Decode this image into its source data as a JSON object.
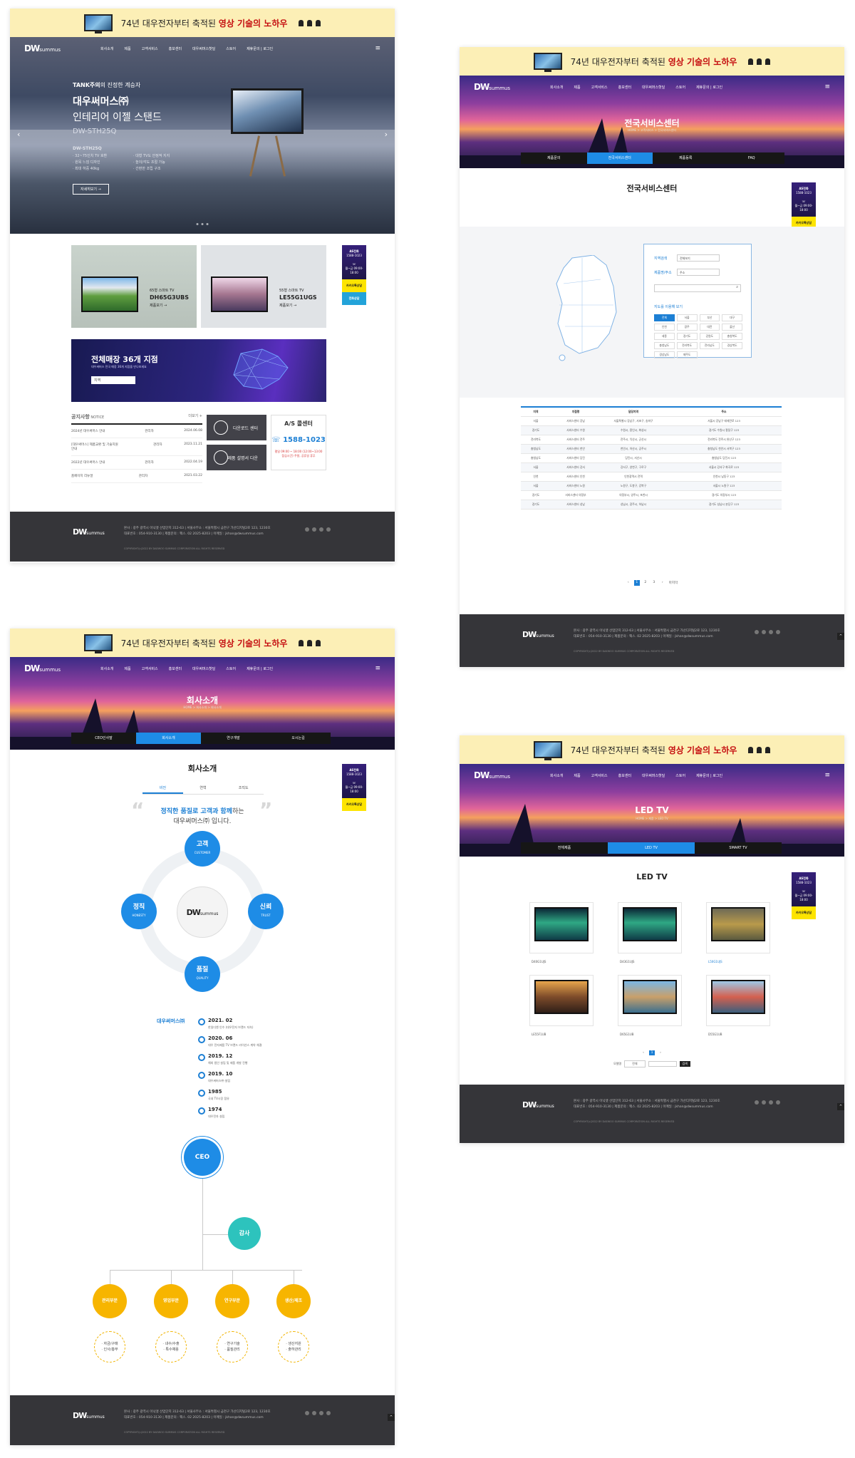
{
  "banner": {
    "prefix": "74년 대우전자부터 축적된 ",
    "highlight": "영상 기술의 노하우"
  },
  "logo": {
    "main": "DW",
    "sub": "summus"
  },
  "nav": [
    "회사소개",
    "제품",
    "고객서비스",
    "홍보센터",
    "대우써머스핫딜",
    "스토어",
    "제휴문의 | 로그인"
  ],
  "main_page": {
    "hero": {
      "sub_prefix": "TANK주의",
      "sub_suffix": "의 진정한 계승자",
      "brand": "대우써머스㈜",
      "title": "인테리어 이젤 스탠드",
      "model": "DW-STH25Q",
      "spec_model": "DW-STH25Q",
      "features": [
        "· 32~75인치 TV 호환",
        "· 대형 TV도 안정적 지지",
        "· 원목 느낌 디자인",
        "· 높이/각도 조절 가능",
        "· 최대 하중 40kg",
        "· 간편한 조립 구조"
      ],
      "button": "자세히보기 →",
      "prev": "‹",
      "next": "›"
    },
    "products": [
      {
        "size": "65형 스마트 TV",
        "model": "DH65G3UBS",
        "link": "제품보기 →"
      },
      {
        "size": "55형 스마트 TV",
        "model": "LE55G1UGS",
        "link": "제품보기 →"
      }
    ],
    "store": {
      "title": "전체매장 36개 지점",
      "desc": "대우써머스 전국 매장 36개 지점을 만나보세요",
      "select": "지역"
    },
    "notice": {
      "title": "공지사항",
      "title_en": "NOTICE",
      "more": "더보기 +",
      "rows": [
        {
          "title": "2024년 대우써머스 안내",
          "author": "관리자",
          "date": "2024.06.08"
        },
        {
          "title": "[대우써머스] 제품교환 및 기술지원 안내",
          "author": "관리자",
          "date": "2023.11.21"
        },
        {
          "title": "2022년 대우써머스 안내",
          "author": "관리자",
          "date": "2022.04.19"
        },
        {
          "title": "홈페이지 리뉴얼",
          "author": "관리자",
          "date": "2021.03.22"
        }
      ]
    },
    "services": [
      {
        "label": "다운로드 센터"
      },
      {
        "label": "제품 설명서 다운"
      }
    ],
    "as_center": {
      "title": "A/S 콜센터",
      "phone": "1588-1023",
      "note": "평일 09:00 ~ 18:00 (12:00~13:00 점심시간) 주말, 공휴일 휴무"
    }
  },
  "float": {
    "as_label": "AS전화",
    "as_phone": "1588-1023",
    "hours": "월~금 09:00-18:00",
    "kakao": "카카오톡상담",
    "blue": "전화상담"
  },
  "service_page": {
    "hero_title": "전국서비스센터",
    "crumb": "HOME > 고객서비스 > 전국서비스센터",
    "tabs": [
      "제품문의",
      "전국서비스센터",
      "제품등록",
      "FAQ"
    ],
    "content_title": "전국서비스센터",
    "search": {
      "label1": "지역검색",
      "select1": "전체보기",
      "label2": "제품명/주소",
      "select2": "주소",
      "region_label": "지도를 이용해 보기",
      "icon": "⌕"
    },
    "regions": [
      "전체",
      "서울",
      "부산",
      "대구",
      "인천",
      "광주",
      "대전",
      "울산",
      "세종",
      "경기도",
      "강원도",
      "충청북도",
      "충청남도",
      "전라북도",
      "전라남도",
      "경상북도",
      "경상남도",
      "제주도"
    ],
    "table": {
      "headers": [
        "지역",
        "지점명",
        "담당지역",
        "주소"
      ],
      "rows": [
        [
          "서울",
          "서비스센터 강남",
          "서울특별시 강남구, 서초구, 송파구",
          "서울시 강남구 테헤란로 123"
        ],
        [
          "경기도",
          "서비스센터 수원",
          "수원시, 용인시, 화성시",
          "경기도 수원시 팔달구 123"
        ],
        [
          "전라북도",
          "서비스센터 전주",
          "전주시, 익산시, 군산시",
          "전라북도 전주시 완산구 123"
        ],
        [
          "충청남도",
          "서비스센터 천안",
          "천안시, 아산시, 공주시",
          "충청남도 천안시 서북구 123"
        ],
        [
          "충청남도",
          "서비스센터 당진",
          "당진시, 서산시",
          "충청남도 당진시 123"
        ],
        [
          "서울",
          "서비스센터 강서",
          "강서구, 양천구, 구로구",
          "서울시 강서구 화곡로 123"
        ],
        [
          "인천",
          "서비스센터 인천",
          "인천광역시 전역",
          "인천시 남동구 123"
        ],
        [
          "서울",
          "서비스센터 노원",
          "노원구, 도봉구, 강북구",
          "서울시 노원구 123"
        ],
        [
          "경기도",
          "서비스센터 의정부",
          "의정부시, 양주시, 포천시",
          "경기도 의정부시 123"
        ],
        [
          "경기도",
          "서비스센터 성남",
          "성남시, 광주시, 하남시",
          "경기도 성남시 분당구 123"
        ]
      ]
    },
    "pager": [
      "‹",
      "1",
      "2",
      "3",
      "›",
      "마지막"
    ]
  },
  "company_page": {
    "hero_title": "회사소개",
    "crumb": "HOME > 회사소개 > 회사소개",
    "tabs": [
      "CEO인사말",
      "회사소개",
      "연구개발",
      "오시는길"
    ],
    "content_title": "회사소개",
    "inner_tabs": [
      "비전",
      "연혁",
      "조직도"
    ],
    "quote": {
      "line1_a": "정직한 품질로 ",
      "line1_b": "고객과 함께",
      "line1_c": "하는",
      "line2": "대우써머스㈜ 입니다."
    },
    "values": [
      {
        "ko": "고객",
        "en": "CUSTOMER"
      },
      {
        "ko": "정직",
        "en": "HONESTY"
      },
      {
        "ko": "신뢰",
        "en": "TRUST"
      },
      {
        "ko": "품질",
        "en": "QUALITY"
      }
    ],
    "history_title": "대우써머스㈜",
    "history": [
      {
        "date": "2021. 02",
        "desc": "한일디앤 인수 (대우전자 브랜드 지속)"
      },
      {
        "date": "2020. 06",
        "desc": "대우 전자제품 TV 브랜드 라이선스 계약 체결"
      },
      {
        "date": "2019. 12",
        "desc": "해외 법인 설립 및 제품 개발 진행"
      },
      {
        "date": "2019. 10",
        "desc": "대우써머스㈜ 설립"
      },
      {
        "date": "1985",
        "desc": "국내 TV시장 점유"
      },
      {
        "date": "1974",
        "desc": "대우전자 설립"
      }
    ],
    "org": {
      "ceo": "CEO",
      "audit": "감사",
      "depts": [
        {
          "name": "관리부문",
          "tasks": [
            "· 자금/구매",
            "· 인사/총무"
          ]
        },
        {
          "name": "영업부문",
          "tasks": [
            "· 내수/수출",
            "· 특수채용"
          ]
        },
        {
          "name": "연구부문",
          "tasks": [
            "· 연구기술",
            "· 품질관리"
          ]
        },
        {
          "name": "생산/제조",
          "tasks": [
            "· 생산지원",
            "· 출하관리"
          ]
        }
      ]
    }
  },
  "led_page": {
    "hero_title": "LED TV",
    "crumb": "HOME > 제품 > LED TV",
    "tabs": [
      "전체제품",
      "LED TV",
      "SMART TV"
    ],
    "content_title": "LED TV",
    "products": [
      "D40G1UJS",
      "D43G1UJS",
      "L50G1UJS",
      "LE55F1UB",
      "D65G1UB",
      "D55G1UB"
    ],
    "search": {
      "label": "모델명",
      "select": "전체",
      "button": "검색"
    },
    "pager": [
      "‹",
      "1",
      "›"
    ]
  },
  "footer": {
    "line1": "본사 : 광주 광역시 이닉엣 산업단지 312-63  |  서울사무소 : 서울특별시 금천구 가산디지털2로 123, 1230호",
    "line2": "대표번호 : 054-910-3130  |  제품문의 : 팩스. 02 2025-8203  |  이메일 : jkhan@dwsummus.com",
    "copy": "COPYRIGHT(c)2022 BY DAEWOO SUMMUS CORPORATION ALL RIGHTS RESERVED"
  },
  "top_button": "^",
  "colors": {
    "accent": "#1e8ce6",
    "banner_bg": "#fcefb6",
    "footer_bg": "#353539",
    "org_yellow": "#f7b500",
    "audit_teal": "#2dc3bd"
  }
}
